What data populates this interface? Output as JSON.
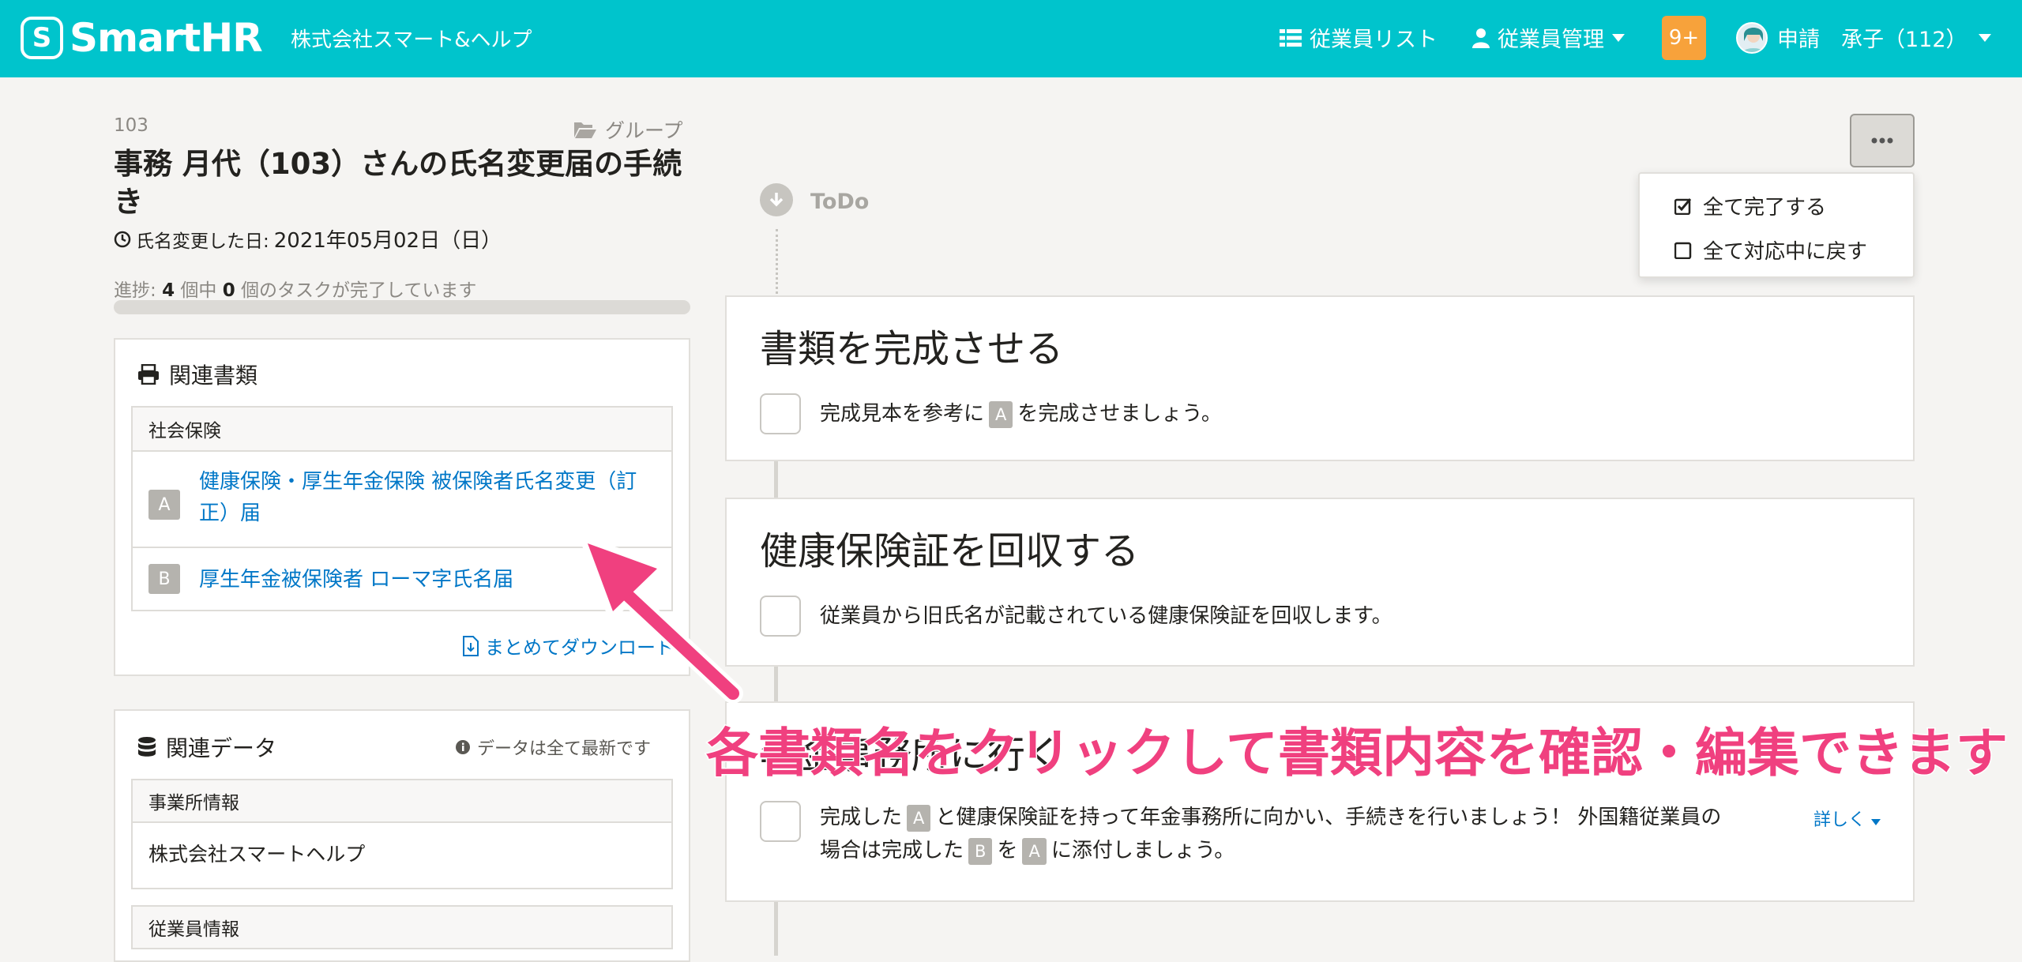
{
  "header": {
    "logo_mark": "S",
    "logo_text": "SmartHR",
    "company": "株式会社スマート&ヘルプ",
    "nav": [
      {
        "icon": "list-icon",
        "label": "従業員リスト"
      },
      {
        "icon": "user-icon",
        "label": "従業員管理"
      }
    ],
    "notification_badge": "9+",
    "user_name": "申請　承子（112）"
  },
  "procedure": {
    "id": "103",
    "group_label": "グループ",
    "title": "事務 月代（103）さんの氏名変更届の手続き",
    "date_label": "氏名変更した日:",
    "date_value": "2021年05月02日（日）",
    "progress_prefix": "進捗:",
    "progress_total": "4",
    "progress_middle": "個中",
    "progress_done": "0",
    "progress_suffix": "個のタスクが完了しています",
    "progress_fraction": 0.0
  },
  "related_docs": {
    "title": "関連書類",
    "section": "社会保険",
    "docs": [
      {
        "badge": "A",
        "name": "健康保険・厚生年金保険 被保険者氏名変更（訂正）届"
      },
      {
        "badge": "B",
        "name": "厚生年金被保険者 ローマ字氏名届"
      }
    ],
    "download_label": "まとめてダウンロード"
  },
  "related_data": {
    "title": "関連データ",
    "status": "データは全て最新です",
    "sections": [
      {
        "label": "事業所情報",
        "value": "株式会社スマートヘルプ"
      },
      {
        "label": "従業員情報",
        "value": ""
      }
    ]
  },
  "timeline": {
    "todo_label": "ToDo",
    "menu": [
      {
        "icon": "checked-box-icon",
        "label": "全て完了する"
      },
      {
        "icon": "empty-box-icon",
        "label": "全て対応中に戻す"
      }
    ],
    "tasks": [
      {
        "title": "書類を完成させる",
        "text_pre": "完成見本を参考に",
        "badge": "A",
        "text_post": "を完成させましょう。"
      },
      {
        "title": "健康保険証を回収する",
        "text": "従業員から旧氏名が記載されている健康保険証を回収します。"
      },
      {
        "title": "年金事務所に行く",
        "line1_a": "完成した",
        "badge1": "A",
        "line1_b": "と健康保険証を持って年金事務所に向かい、手続きを行いましょう！ 外国籍従業員の",
        "line2_a": "場合は完成した",
        "badge2": "B",
        "line2_b": "を",
        "badge3": "A",
        "line2_c": "に添付しましょう。",
        "details_label": "詳しく"
      }
    ]
  },
  "annotation": {
    "text": "各書類名をクリックして書類内容を確認・編集できます",
    "color": "#f0407f"
  }
}
